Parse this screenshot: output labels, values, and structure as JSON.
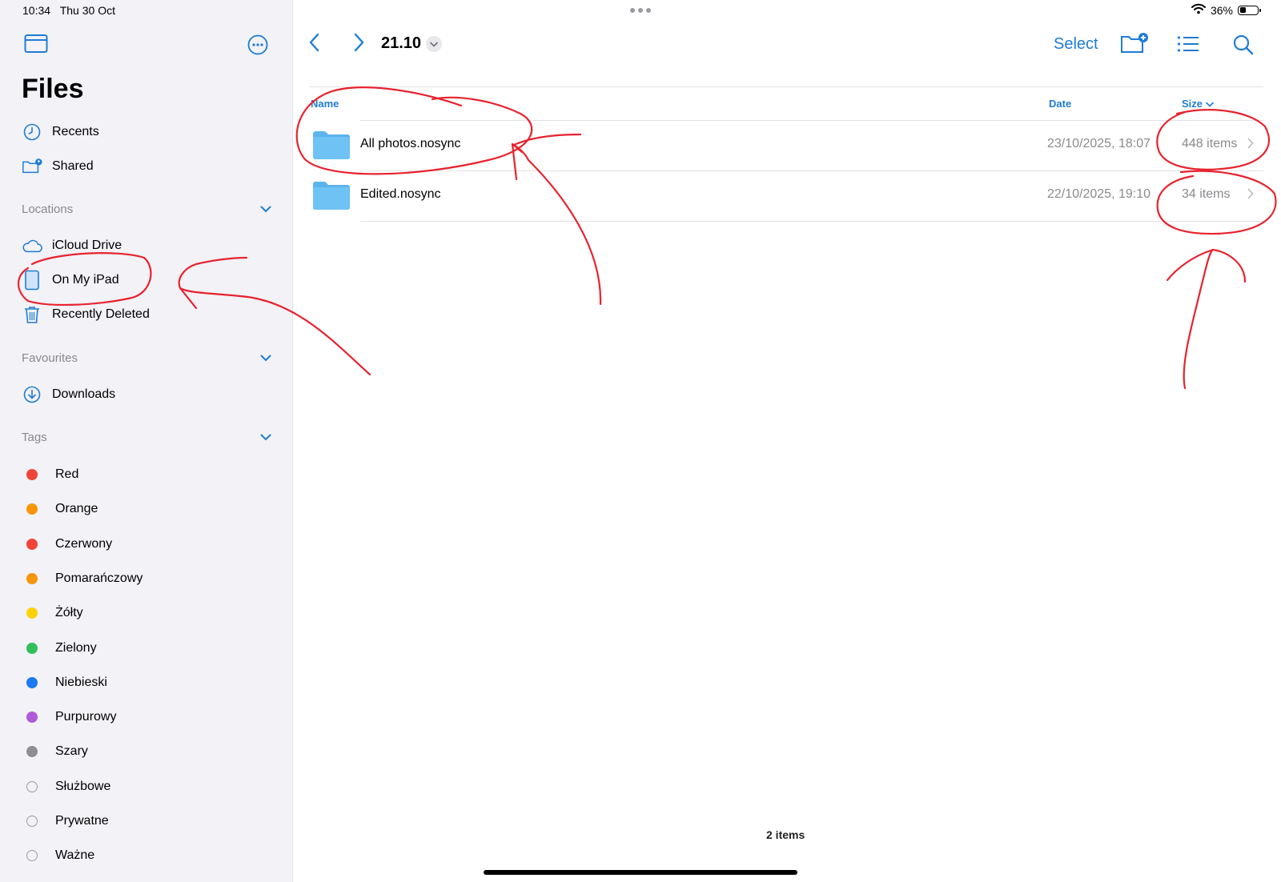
{
  "status_bar": {
    "time": "10:34",
    "date": "Thu 30 Oct",
    "battery": "36%",
    "battery_level": 0.36
  },
  "sidebar": {
    "title": "Files",
    "items": [
      {
        "label": "Recents",
        "icon": "clock-icon"
      },
      {
        "label": "Shared",
        "icon": "shared-folder-icon"
      }
    ],
    "locations": {
      "header": "Locations",
      "items": [
        {
          "label": "iCloud Drive",
          "icon": "cloud-icon"
        },
        {
          "label": "On My iPad",
          "icon": "ipad-icon"
        },
        {
          "label": "Recently Deleted",
          "icon": "trash-icon"
        }
      ]
    },
    "favourites": {
      "header": "Favourites",
      "items": [
        {
          "label": "Downloads",
          "icon": "download-icon"
        }
      ]
    },
    "tags": {
      "header": "Tags",
      "items": [
        {
          "label": "Red",
          "color": "#f0443a"
        },
        {
          "label": "Orange",
          "color": "#f7950c"
        },
        {
          "label": "Czerwony",
          "color": "#f0443a"
        },
        {
          "label": "Pomarańczowy",
          "color": "#f7950c"
        },
        {
          "label": "Żółty",
          "color": "#fdd10a"
        },
        {
          "label": "Zielony",
          "color": "#33c05a"
        },
        {
          "label": "Niebieski",
          "color": "#1d79f2"
        },
        {
          "label": "Purpurowy",
          "color": "#b05ad8"
        },
        {
          "label": "Szary",
          "color": "#8e8e93"
        },
        {
          "label": "Służbowe",
          "color": ""
        },
        {
          "label": "Prywatne",
          "color": ""
        },
        {
          "label": "Ważne",
          "color": ""
        }
      ]
    }
  },
  "toolbar": {
    "folder_title": "21.10",
    "select_label": "Select"
  },
  "columns": {
    "name": "Name",
    "date": "Date",
    "size": "Size"
  },
  "files": [
    {
      "name": "All photos.nosync",
      "date": "23/10/2025, 18:07",
      "size": "448 items"
    },
    {
      "name": "Edited.nosync",
      "date": "22/10/2025, 19:10",
      "size": "34 items"
    }
  ],
  "footer": {
    "count": "2 items"
  },
  "colors": {
    "accent": "#1e7cd6",
    "annotation": "#e8222e",
    "sidebar_bg": "#f2f2f7"
  }
}
